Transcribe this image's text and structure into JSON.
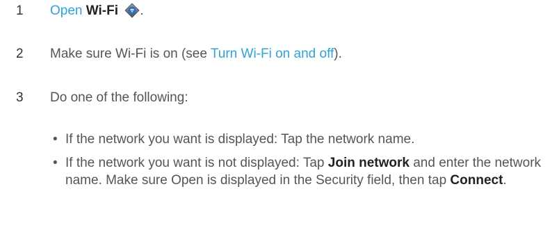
{
  "steps": [
    {
      "number": "1",
      "parts": {
        "link": "Open",
        "bold": "Wi-Fi",
        "icon": "wifi-settings-icon",
        "after": "."
      }
    },
    {
      "number": "2",
      "parts": {
        "before": "Make sure Wi-Fi is on (see ",
        "link": "Turn Wi-Fi on and off",
        "after": ")."
      }
    },
    {
      "number": "3",
      "parts": {
        "text": "Do one of the following:"
      }
    }
  ],
  "bullets": [
    {
      "dot": "•",
      "text": "If the network you want is displayed: Tap the network name."
    },
    {
      "dot": "•",
      "before": "If the network you want is not displayed: Tap ",
      "bold1": "Join network",
      "middle": " and enter the network name. Make sure Open is displayed in the Security field, then tap ",
      "bold2": "Connect",
      "after": "."
    }
  ],
  "colors": {
    "link": "#2fa3d7",
    "text": "#555555",
    "bold": "#222222"
  }
}
